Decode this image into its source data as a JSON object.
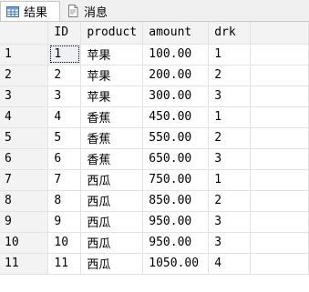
{
  "tabs": [
    {
      "label": "结果",
      "icon": "grid-icon",
      "active": true
    },
    {
      "label": "消息",
      "icon": "message-icon",
      "active": false
    }
  ],
  "columns": [
    "ID",
    "product",
    "amount",
    "drk"
  ],
  "rows": [
    {
      "rownum": "1",
      "ID": "1",
      "product": "苹果",
      "amount": "100.00",
      "drk": "1"
    },
    {
      "rownum": "2",
      "ID": "2",
      "product": "苹果",
      "amount": "200.00",
      "drk": "2"
    },
    {
      "rownum": "3",
      "ID": "3",
      "product": "苹果",
      "amount": "300.00",
      "drk": "3"
    },
    {
      "rownum": "4",
      "ID": "4",
      "product": "香蕉",
      "amount": "450.00",
      "drk": "1"
    },
    {
      "rownum": "5",
      "ID": "5",
      "product": "香蕉",
      "amount": "550.00",
      "drk": "2"
    },
    {
      "rownum": "6",
      "ID": "6",
      "product": "香蕉",
      "amount": "650.00",
      "drk": "3"
    },
    {
      "rownum": "7",
      "ID": "7",
      "product": "西瓜",
      "amount": "750.00",
      "drk": "1"
    },
    {
      "rownum": "8",
      "ID": "8",
      "product": "西瓜",
      "amount": "850.00",
      "drk": "2"
    },
    {
      "rownum": "9",
      "ID": "9",
      "product": "西瓜",
      "amount": "950.00",
      "drk": "3"
    },
    {
      "rownum": "10",
      "ID": "10",
      "product": "西瓜",
      "amount": "950.00",
      "drk": "3"
    },
    {
      "rownum": "11",
      "ID": "11",
      "product": "西瓜",
      "amount": "1050.00",
      "drk": "4"
    }
  ]
}
